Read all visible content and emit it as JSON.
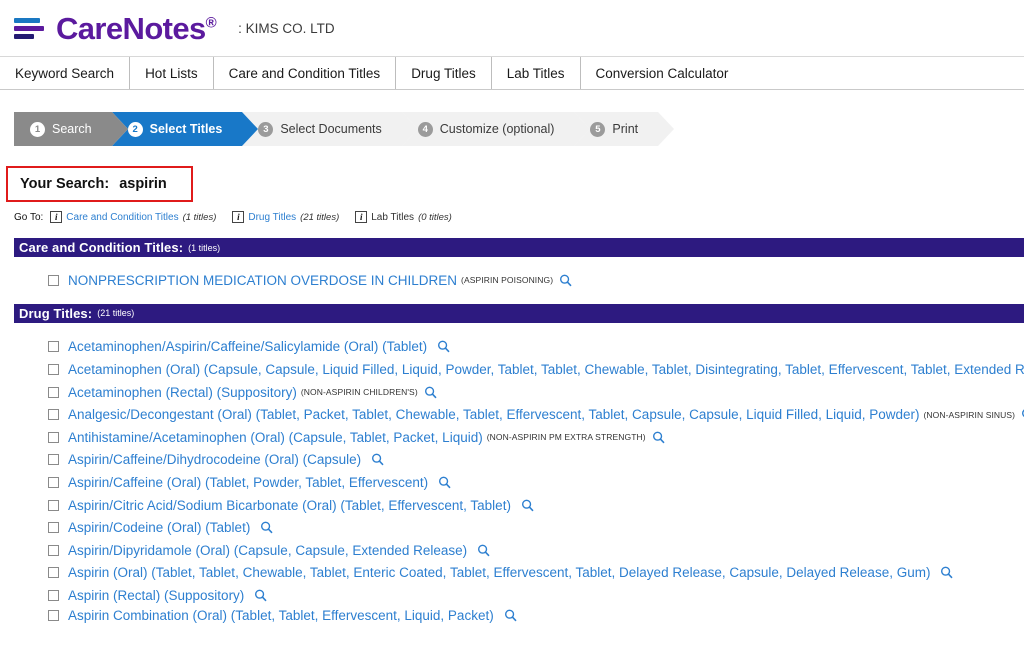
{
  "header": {
    "logo_text": "CareNotes",
    "logo_sup": "®",
    "org_name": ": KIMS CO. LTD"
  },
  "nav": {
    "items": [
      {
        "label": "Keyword Search"
      },
      {
        "label": "Hot Lists"
      },
      {
        "label": "Care and Condition Titles"
      },
      {
        "label": "Drug Titles"
      },
      {
        "label": "Lab Titles"
      },
      {
        "label": "Conversion Calculator"
      }
    ]
  },
  "wizard": {
    "steps": [
      {
        "num": "1",
        "label": "Search",
        "state": "done"
      },
      {
        "num": "2",
        "label": "Select Titles",
        "state": "active"
      },
      {
        "num": "3",
        "label": "Select Documents",
        "state": "todo"
      },
      {
        "num": "4",
        "label": "Customize (optional)",
        "state": "todo"
      },
      {
        "num": "5",
        "label": "Print",
        "state": "todo"
      }
    ]
  },
  "search": {
    "label": "Your Search:",
    "term": "aspirin",
    "border_color": "#e01b1b"
  },
  "goto": {
    "label": "Go To:",
    "icon": "info-icon",
    "links": [
      {
        "label": "Care and Condition Titles",
        "count": "(1 titles)",
        "enabled": true
      },
      {
        "label": "Drug Titles",
        "count": "(21 titles)",
        "enabled": true
      },
      {
        "label": "Lab Titles",
        "count": "(0 titles)",
        "enabled": false
      }
    ]
  },
  "sections": [
    {
      "id": "care-and-condition-titles",
      "title": "Care and Condition Titles:",
      "count": "(1 titles)",
      "bar_color": "#2d1a80",
      "rows": [
        {
          "title": "NONPRESCRIPTION MEDICATION OVERDOSE IN CHILDREN",
          "alias": "(ASPIRIN POISONING)",
          "checked": false,
          "preview_icon": "magnifier-icon"
        }
      ]
    },
    {
      "id": "drug-titles",
      "title": "Drug Titles:",
      "count": "(21 titles)",
      "bar_color": "#2d1a80",
      "rows": [
        {
          "title": "Acetaminophen/Aspirin/Caffeine/Salicylamide (Oral) (Tablet)",
          "alias": "",
          "checked": false,
          "preview_icon": "magnifier-icon"
        },
        {
          "title": "Acetaminophen (Oral) (Capsule, Capsule, Liquid Filled, Liquid, Powder, Tablet, Tablet, Chewable, Tablet, Disintegrating, Tablet, Effervescent, Tablet, Extended Release)",
          "alias": "",
          "checked": false,
          "preview_icon": "magnifier-icon"
        },
        {
          "title": "Acetaminophen (Rectal) (Suppository)",
          "alias": "(NON-ASPIRIN CHILDREN'S)",
          "checked": false,
          "preview_icon": "magnifier-icon"
        },
        {
          "title": "Analgesic/Decongestant (Oral) (Tablet, Packet, Tablet, Chewable, Tablet, Effervescent, Tablet, Capsule, Capsule, Liquid Filled, Liquid, Powder)",
          "alias": "(NON-ASPIRIN SINUS)",
          "checked": false,
          "preview_icon": "magnifier-icon"
        },
        {
          "title": "Antihistamine/Acetaminophen (Oral) (Capsule, Tablet, Packet, Liquid)",
          "alias": "(NON-ASPIRIN PM EXTRA STRENGTH)",
          "checked": false,
          "preview_icon": "magnifier-icon"
        },
        {
          "title": "Aspirin/Caffeine/Dihydrocodeine (Oral) (Capsule)",
          "alias": "",
          "checked": false,
          "preview_icon": "magnifier-icon"
        },
        {
          "title": "Aspirin/Caffeine (Oral) (Tablet, Powder, Tablet, Effervescent)",
          "alias": "",
          "checked": false,
          "preview_icon": "magnifier-icon"
        },
        {
          "title": "Aspirin/Citric Acid/Sodium Bicarbonate (Oral) (Tablet, Effervescent, Tablet)",
          "alias": "",
          "checked": false,
          "preview_icon": "magnifier-icon"
        },
        {
          "title": "Aspirin/Codeine (Oral) (Tablet)",
          "alias": "",
          "checked": false,
          "preview_icon": "magnifier-icon"
        },
        {
          "title": "Aspirin/Dipyridamole (Oral) (Capsule, Capsule, Extended Release)",
          "alias": "",
          "checked": false,
          "preview_icon": "magnifier-icon"
        },
        {
          "title": "Aspirin (Oral) (Tablet, Tablet, Chewable, Tablet, Enteric Coated, Tablet, Effervescent, Tablet, Delayed Release, Capsule, Delayed Release, Gum)",
          "alias": "",
          "checked": false,
          "preview_icon": "magnifier-icon"
        },
        {
          "title": "Aspirin (Rectal) (Suppository)",
          "alias": "",
          "checked": false,
          "preview_icon": "magnifier-icon"
        },
        {
          "title": "Aspirin Combination (Oral) (Tablet, Tablet, Effervescent, Liquid, Packet)",
          "alias": "",
          "checked": false,
          "preview_icon": "magnifier-icon"
        }
      ]
    }
  ],
  "colors": {
    "link": "#2d7fd0",
    "brand_purple": "#5b1a9e",
    "section_bar": "#2d1a80",
    "active_step": "#1878c8",
    "done_step": "#8a8a8a"
  }
}
